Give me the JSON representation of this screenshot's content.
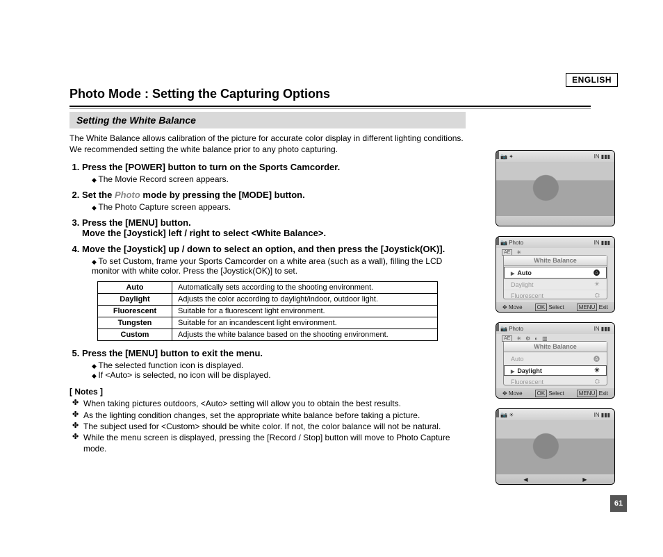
{
  "header": {
    "language": "ENGLISH",
    "page_number": "61",
    "title": "Photo Mode : Setting the Capturing Options",
    "section": "Setting the White Balance"
  },
  "intro": "The White Balance allows calibration of the picture for accurate color display in different lighting conditions. We recommended setting the white balance prior to any photo capturing.",
  "steps": {
    "s1": {
      "text": "Press the [POWER] button to turn on the Sports Camcorder.",
      "sub1": "The Movie Record screen appears."
    },
    "s2": {
      "pre": "Set the ",
      "photo": "Photo",
      "post": " mode by pressing the [MODE] button.",
      "sub1": "The Photo Capture screen appears."
    },
    "s3": {
      "line1": "Press the [MENU] button.",
      "line2": "Move the [Joystick] left / right to select <White Balance>."
    },
    "s4": {
      "text": "Move the [Joystick] up / down to select an option, and then press the [Joystick(OK)].",
      "sub1": "To set Custom, frame  your Sports Camcorder on a white area (such as a wall), filling the LCD monitor with white color. Press the [Joystick(OK)] to set."
    },
    "s5": {
      "text": "Press the [MENU] button to exit the menu.",
      "sub1": "The selected function icon is displayed.",
      "sub2": "If <Auto> is selected, no icon will be displayed."
    }
  },
  "table": {
    "r0l": "Auto",
    "r0d": "Automatically sets according to the shooting environment.",
    "r1l": "Daylight",
    "r1d": "Adjusts the color according to daylight/indoor, outdoor light.",
    "r2l": "Fluorescent",
    "r2d": "Suitable for a fluorescent light environment.",
    "r3l": "Tungsten",
    "r3d": "Suitable for an incandescent light environment.",
    "r4l": "Custom",
    "r4d": "Adjusts the white balance based on the shooting environment."
  },
  "notes_head": "[ Notes ]",
  "notes": {
    "n1": "When taking pictures outdoors, <Auto> setting will allow you to obtain the best results.",
    "n2": "As the lighting condition changes, set the appropriate white balance before taking a picture.",
    "n3": "The subject used for <Custom> should be white color. If not, the color balance will not be natural.",
    "n4": "While the menu screen is displayed, pressing the [Record / Stop] button will move to Photo Capture mode."
  },
  "screens": {
    "n2": "2",
    "n3": "3",
    "n4": "4",
    "n5": "5",
    "photo_label": "Photo",
    "in_label": "IN",
    "menu_title": "White Balance",
    "auto": "Auto",
    "daylight": "Daylight",
    "fluorescent": "Fluorescent",
    "move": "Move",
    "select": "Select",
    "exit": "Exit",
    "ok": "OK",
    "menu": "MENU",
    "ae": "AE"
  }
}
